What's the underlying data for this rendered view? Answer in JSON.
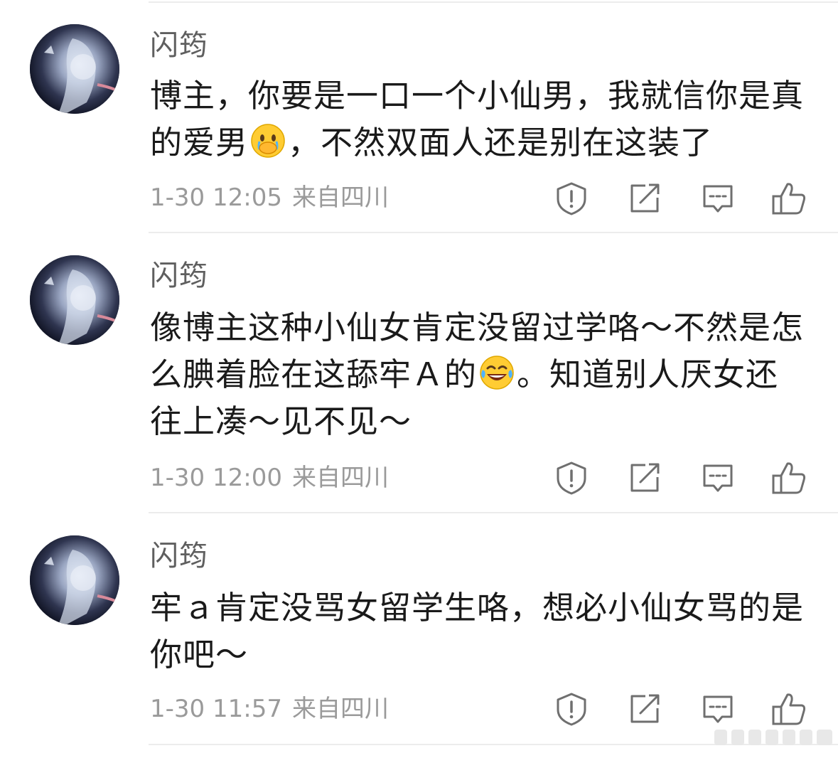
{
  "comments": [
    {
      "username": "闪筠",
      "text_1": "博主，你要是一口一个小仙男，我就信你是真的爱男",
      "emoji_1": "face-holding-back-tears",
      "text_2": "，不然双面人还是别在这装了",
      "timestamp": "1-30 12:05",
      "location": "来自四川"
    },
    {
      "username": "闪筠",
      "text_1": "像博主这种小仙女肯定没留过学咯～不然是怎么腆着脸在这舔牢Ａ的",
      "emoji_1": "face-with-tears-of-joy",
      "text_2": "。知道别人厌女还往上凑～见不见～",
      "timestamp": "1-30 12:00",
      "location": "来自四川"
    },
    {
      "username": "闪筠",
      "text_1": "牢ａ肯定没骂女留学生咯，想必小仙女骂的是你吧～",
      "timestamp": "1-30 11:57",
      "location": "来自四川"
    }
  ],
  "icons": {
    "report": "report-icon",
    "repost": "repost-icon",
    "reply": "comment-icon",
    "like": "thumbs-up-icon"
  },
  "colors": {
    "text": "#1a1a1a",
    "username": "#5f5f5f",
    "meta": "#9a9a9a",
    "icon": "#6f6f6f",
    "divider": "#ececec"
  }
}
